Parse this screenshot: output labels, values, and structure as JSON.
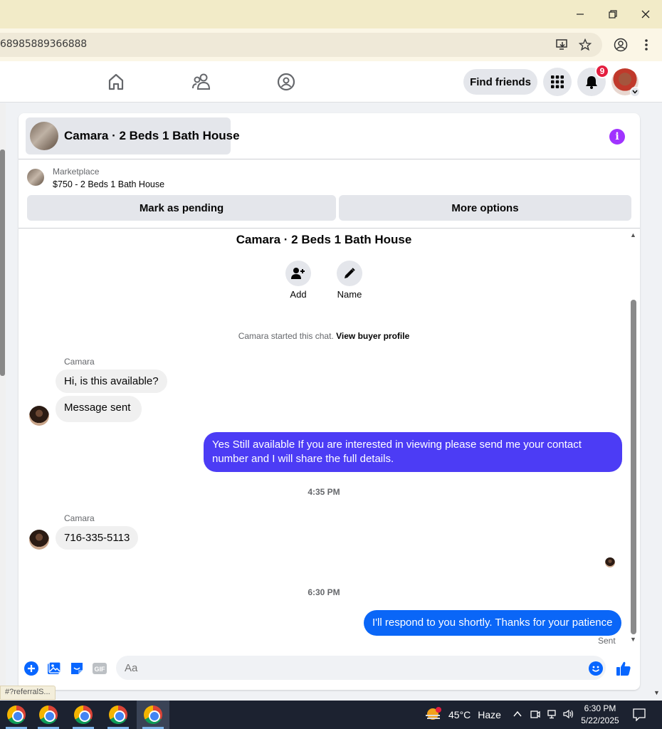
{
  "browser": {
    "url": "68985889366888",
    "status_url": "#?referralS..."
  },
  "fbnav": {
    "find_friends": "Find friends",
    "notification_count": "9"
  },
  "chat": {
    "header_title": "Camara · 2 Beds 1 Bath House",
    "marketplace_label": "Marketplace",
    "listing_price_title": "$750 - 2 Beds 1 Bath House",
    "mark_pending": "Mark as pending",
    "more_options": "More options",
    "conversation_title": "Camara · 2 Beds 1 Bath House",
    "add_label": "Add",
    "name_label": "Name",
    "started_text": "Camara started this chat.",
    "view_buyer_profile": "View buyer profile",
    "messages": [
      {
        "sender": "Camara",
        "text": "Hi, is this available?"
      },
      {
        "text": "Message sent"
      },
      {
        "text": "Yes Still available If you are interested in viewing please send me your contact number and I will share the full details.",
        "color": "#4c3cf5"
      },
      {
        "time": "4:35 PM"
      },
      {
        "sender": "Camara",
        "text": "716-335-5113"
      },
      {
        "time": "6:30 PM"
      },
      {
        "text": "I'll respond to you shortly. Thanks for your patience",
        "color": "#0a66f7"
      }
    ],
    "sent_label": "Sent",
    "composer_placeholder": "Aa"
  },
  "taskbar": {
    "temperature": "45°C",
    "weather": "Haze",
    "time": "6:30 PM",
    "date": "5/22/2025"
  },
  "colors": {
    "accent_blue": "#0866ff",
    "purple_bubble": "#4c3cf5",
    "info_purple": "#a033ff"
  }
}
